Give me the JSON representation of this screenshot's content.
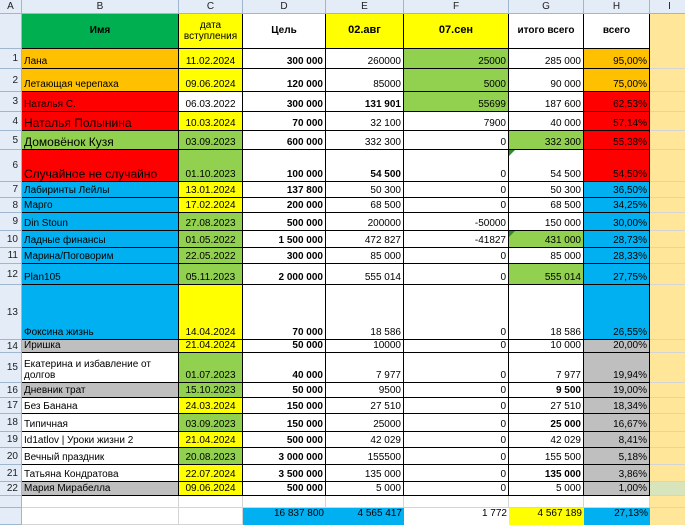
{
  "columns": [
    "A",
    "B",
    "C",
    "D",
    "E",
    "F",
    "G",
    "H",
    "I"
  ],
  "header": {
    "name": "Имя",
    "date": "дата вступления",
    "goal": "Цель",
    "aug": "02.авг",
    "sep": "07.сен",
    "total": "итого всего",
    "all": "всего"
  },
  "rows": [
    {
      "n": "1",
      "name": "Лана",
      "date": "11.02.2024",
      "goal": "300 000",
      "aug": "260000",
      "sep": "25000",
      "total": "285 000",
      "pct": "95,00%"
    },
    {
      "n": "2",
      "name": "Летающая черепаха",
      "date": "09.06.2024",
      "goal": "120 000",
      "aug": "85000",
      "sep": "5000",
      "total": "90 000",
      "pct": "75,00%"
    },
    {
      "n": "3",
      "name": "Наталья С.",
      "date": "06.03.2022",
      "goal": "300 000",
      "aug": "131 901",
      "sep": "55699",
      "total": "187 600",
      "pct": "62,53%"
    },
    {
      "n": "4",
      "name": "Наталья Полынина",
      "date": "10.03.2024",
      "goal": "70 000",
      "aug": "32 100",
      "sep": "7900",
      "total": "40 000",
      "pct": "57,14%"
    },
    {
      "n": "5",
      "name": "Домовёнок Кузя",
      "date": "03.09.2023",
      "goal": "600 000",
      "aug": "332 300",
      "sep": "0",
      "total": "332 300",
      "pct": "55,38%"
    },
    {
      "n": "6",
      "name": "Случайное не случайно",
      "date": "01.10.2023",
      "goal": "100 000",
      "aug": "54 500",
      "sep": "0",
      "total": "54 500",
      "pct": "54,50%"
    },
    {
      "n": "7",
      "name": "Лабиринты Лейлы",
      "date": "13.01.2024",
      "goal": "137 800",
      "aug": "50 300",
      "sep": "0",
      "total": "50 300",
      "pct": "36,50%"
    },
    {
      "n": "8",
      "name": "Марго",
      "date": "17.02.2024",
      "goal": "200 000",
      "aug": "68 500",
      "sep": "0",
      "total": "68 500",
      "pct": "34,25%"
    },
    {
      "n": "9",
      "name": "Din Stoun",
      "date": "27.08.2023",
      "goal": "500 000",
      "aug": "200000",
      "sep": "-50000",
      "total": "150 000",
      "pct": "30,00%"
    },
    {
      "n": "10",
      "name": "Ладные финансы",
      "date": "01.05.2022",
      "goal": "1 500 000",
      "aug": "472 827",
      "sep": "-41827",
      "total": "431 000",
      "pct": "28,73%"
    },
    {
      "n": "11",
      "name": "Марина/Поговорим",
      "date": "22.05.2022",
      "goal": "300 000",
      "aug": "85 000",
      "sep": "0",
      "total": "85 000",
      "pct": "28,33%"
    },
    {
      "n": "12",
      "name": "Plan105",
      "date": "05.11.2023",
      "goal": "2 000 000",
      "aug": "555 014",
      "sep": "0",
      "total": "555 014",
      "pct": "27,75%"
    },
    {
      "n": "13",
      "name": "Фоксина жизнь",
      "date": "14.04.2024",
      "goal": "70 000",
      "aug": "18 586",
      "sep": "0",
      "total": "18 586",
      "pct": "26,55%"
    },
    {
      "n": "14",
      "name": "Иришка",
      "date": "21.04.2024",
      "goal": "50 000",
      "aug": "10000",
      "sep": "0",
      "total": "10 000",
      "pct": "20,00%"
    },
    {
      "n": "15",
      "name": "Екатерина и избавление от долгов",
      "date": "01.07.2023",
      "goal": "40 000",
      "aug": "7 977",
      "sep": "0",
      "total": "7 977",
      "pct": "19,94%"
    },
    {
      "n": "16",
      "name": "Дневник трат",
      "date": "15.10.2023",
      "goal": "50 000",
      "aug": "9500",
      "sep": "0",
      "total": "9 500",
      "pct": "19,00%"
    },
    {
      "n": "17",
      "name": "Без Банана",
      "date": "24.03.2024",
      "goal": "150 000",
      "aug": "27 510",
      "sep": "0",
      "total": "27 510",
      "pct": "18,34%"
    },
    {
      "n": "18",
      "name": "Типичная",
      "date": "03.09.2023",
      "goal": "150 000",
      "aug": "25000",
      "sep": "0",
      "total": "25 000",
      "pct": "16,67%"
    },
    {
      "n": "19",
      "name": "Id1atlov |  Уроки жизни 2",
      "date": "21.04.2024",
      "goal": "500 000",
      "aug": "42 029",
      "sep": "0",
      "total": "42 029",
      "pct": "8,41%"
    },
    {
      "n": "20",
      "name": "Вечный праздник",
      "date": "20.08.2023",
      "goal": "3 000 000",
      "aug": "155500",
      "sep": "0",
      "total": "155 500",
      "pct": "5,18%"
    },
    {
      "n": "21",
      "name": "Татьяна Кондратова",
      "date": "22.07.2024",
      "goal": "3 500 000",
      "aug": "135 000",
      "sep": "0",
      "total": "135 000",
      "pct": "3,86%"
    },
    {
      "n": "22",
      "name": "Мария Мирабелла",
      "date": "09.06.2024",
      "goal": "500 000",
      "aug": "5 000",
      "sep": "0",
      "total": "5 000",
      "pct": "1,00%"
    }
  ],
  "totals": {
    "goal": "16 837 800",
    "aug": "4 565 417",
    "sep": "1 772",
    "total": "4 567 189",
    "pct": "27,13%"
  },
  "colors": {
    "green": "#92d050",
    "yellow": "#ffff00",
    "orange": "#ffc000",
    "red": "#ff0000",
    "blue": "#00b0f0",
    "gray": "#bfbfbf",
    "header_green": "#00b050",
    "pale": "#ffe699"
  }
}
